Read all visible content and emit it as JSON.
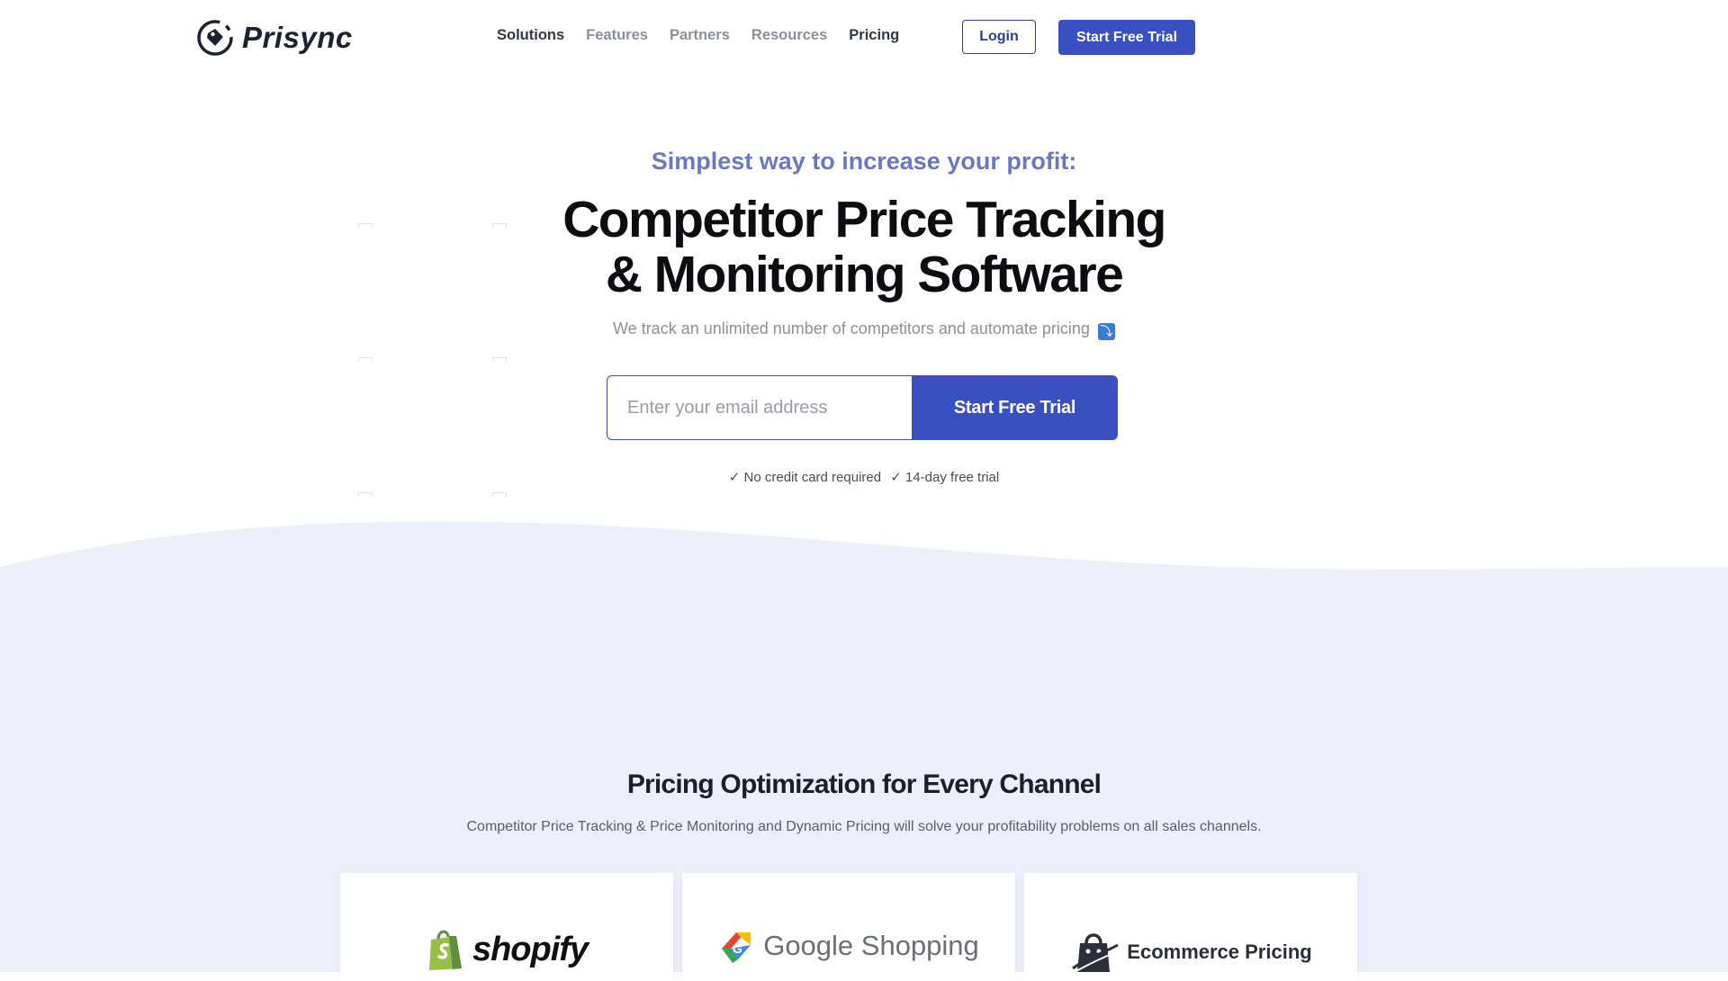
{
  "header": {
    "logo_text": "Prisync",
    "nav": [
      "Solutions",
      "Features",
      "Partners",
      "Resources",
      "Pricing"
    ],
    "login_label": "Login",
    "trial_label": "Start Free Trial"
  },
  "hero": {
    "eyebrow": "Simplest way to increase your profit:",
    "title_line1": "Competitor Price Tracking",
    "title_line2": "& Monitoring Software",
    "subtitle": "We track an unlimited number of competitors and automate pricing",
    "subtitle_icon": "⤵",
    "email_placeholder": "Enter your email address",
    "email_value": "",
    "cta_label": "Start Free Trial",
    "perk1": "✓ No credit card required",
    "perk2": "✓ 14-day free trial"
  },
  "channels": {
    "title": "Pricing Optimization for Every Channel",
    "subtitle": "Competitor Price Tracking & Price Monitoring and Dynamic Pricing will solve your profitability problems on all sales channels.",
    "cards": [
      {
        "label": "shopify",
        "icon": "shopify-bag-icon"
      },
      {
        "label": "Google Shopping",
        "icon": "google-shopping-tag-icon"
      },
      {
        "label": "Ecommerce Pricing",
        "icon": "ecommerce-bag-icon"
      }
    ]
  },
  "colors": {
    "primary": "#3a4fc0",
    "accent_text": "#6a78c0",
    "section_bg": "#eceefa"
  }
}
